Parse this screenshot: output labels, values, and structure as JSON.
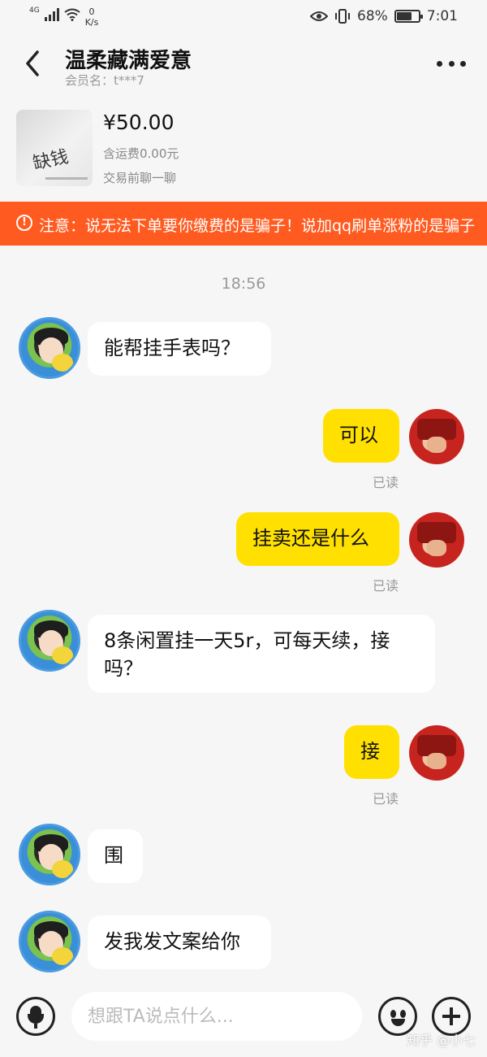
{
  "status_bar": {
    "network": "4G",
    "net_speed_value": "0",
    "net_speed_unit": "K/s",
    "battery": "68%",
    "battery_level": 0.68,
    "time": "7:01"
  },
  "header": {
    "title": "温柔藏满爱意",
    "member_label": "会员名：t***7"
  },
  "product": {
    "price": "¥50.00",
    "shipping": "含运费0.00元",
    "pre_chat": "交易前聊一聊",
    "image_text": "缺钱"
  },
  "warning": {
    "text": "注意：说无法下单要你缴费的是骗子！说加qq刷单涨粉的是骗子"
  },
  "chat": {
    "timestamp": "18:56",
    "messages": [
      {
        "side": "in",
        "text": "能帮挂手表吗？"
      },
      {
        "side": "out",
        "text": "可以",
        "status": "已读"
      },
      {
        "side": "out",
        "text": "挂卖还是什么",
        "status": "已读"
      },
      {
        "side": "in",
        "text": "8条闲置挂一天5r，可每天续，接吗？"
      },
      {
        "side": "out",
        "text": "接",
        "status": "已读"
      },
      {
        "side": "in",
        "text": "围"
      },
      {
        "side": "in",
        "text": "发我发文案给你"
      }
    ]
  },
  "input_bar": {
    "placeholder": "想跟TA说点什么..."
  },
  "watermark": "知乎 @小七",
  "colors": {
    "warning_bg": "#ff5a1f",
    "outgoing_bubble": "#ffe000",
    "incoming_bubble": "#ffffff",
    "background": "#f6f6f6"
  }
}
